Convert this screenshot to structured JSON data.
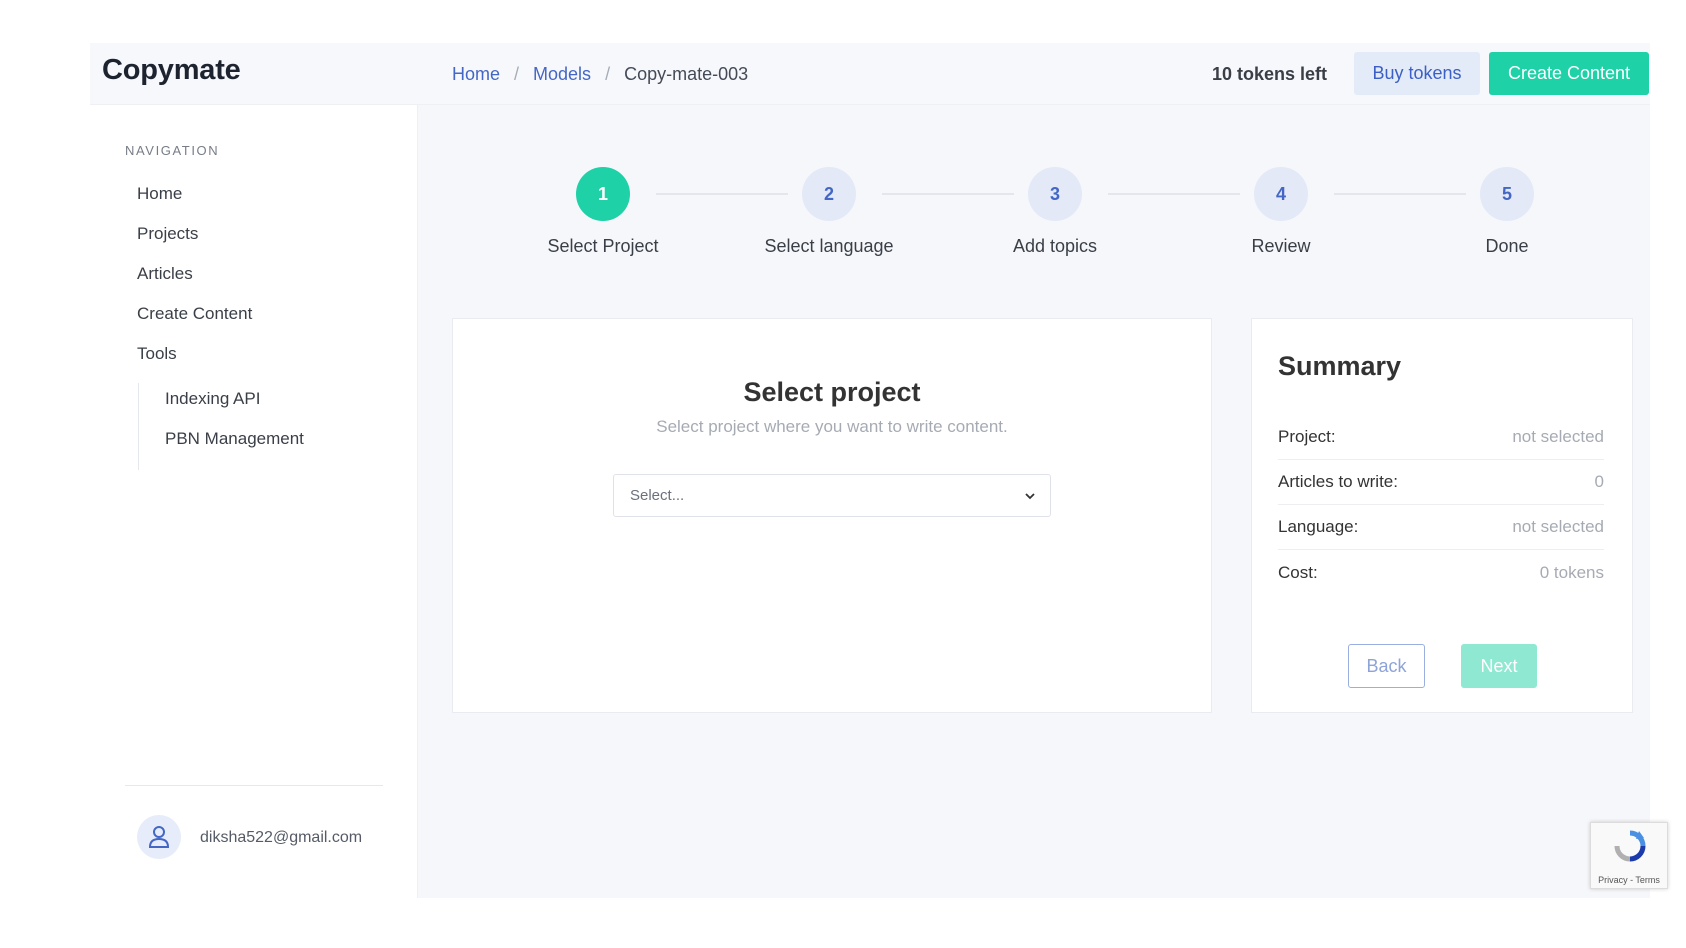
{
  "header": {
    "logo": "Copymate",
    "breadcrumb": [
      {
        "label": "Home"
      },
      {
        "label": "Models"
      },
      {
        "label": "Copy-mate-003"
      }
    ],
    "tokens_left": "10 tokens left",
    "buy_tokens_label": "Buy tokens",
    "create_content_label": "Create Content"
  },
  "sidebar": {
    "heading": "NAVIGATION",
    "items": [
      {
        "label": "Home"
      },
      {
        "label": "Projects"
      },
      {
        "label": "Articles"
      },
      {
        "label": "Create Content"
      },
      {
        "label": "Tools"
      }
    ],
    "tools_subitems": [
      {
        "label": "Indexing API"
      },
      {
        "label": "PBN Management"
      }
    ],
    "user": {
      "email": "diksha522@gmail.com",
      "icon": "user-icon"
    }
  },
  "stepper": {
    "current_step": 1,
    "steps": [
      {
        "number": "1",
        "label": "Select Project"
      },
      {
        "number": "2",
        "label": "Select language"
      },
      {
        "number": "3",
        "label": "Add topics"
      },
      {
        "number": "4",
        "label": "Review"
      },
      {
        "number": "5",
        "label": "Done"
      }
    ]
  },
  "select_card": {
    "title": "Select project",
    "subtitle": "Select project where you want to write content.",
    "select_placeholder": "Select..."
  },
  "summary": {
    "title": "Summary",
    "rows": [
      {
        "key": "Project:",
        "value": "not selected"
      },
      {
        "key": "Articles to write:",
        "value": "0"
      },
      {
        "key": "Language:",
        "value": "not selected"
      },
      {
        "key": "Cost:",
        "value": "0 tokens"
      }
    ],
    "back_label": "Back",
    "next_label": "Next"
  },
  "recaptcha": {
    "text": "Privacy - Terms"
  },
  "colors": {
    "accent": "#1fd1a6",
    "link": "#4467c5",
    "buy_button_bg": "#e4ebf8",
    "disabled_next": "#8fe8d1"
  }
}
